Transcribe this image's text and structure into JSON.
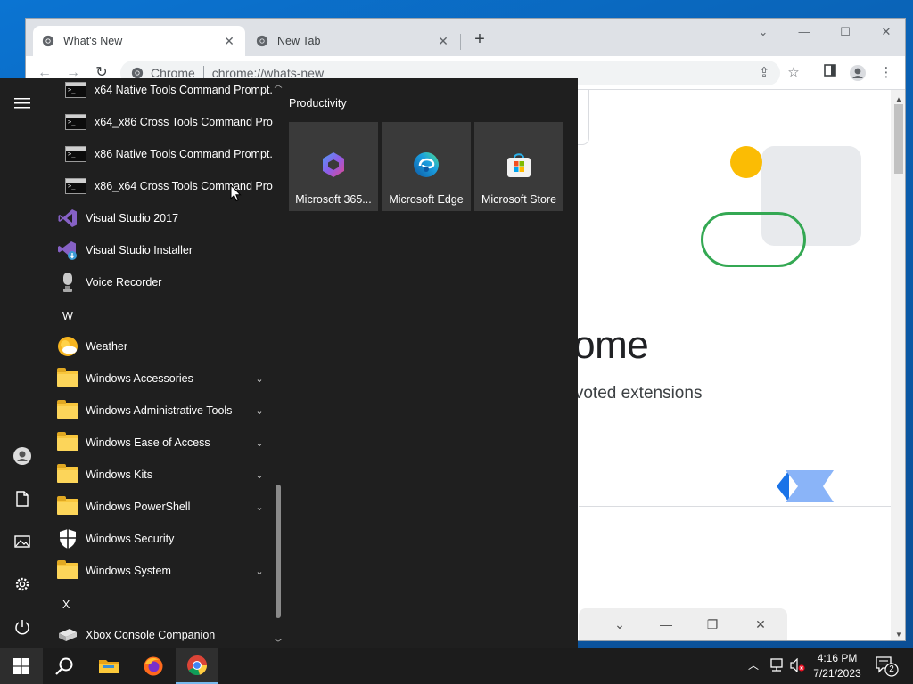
{
  "browser": {
    "tabs": [
      {
        "title": "What's New",
        "active": true
      },
      {
        "title": "New Tab",
        "active": false
      }
    ],
    "omnibox": {
      "site": "Chrome",
      "url": "chrome://whats-new"
    },
    "page": {
      "heading_fragment": "rome",
      "subtext_fragment": "o voted extensions"
    }
  },
  "start_menu": {
    "app_list": [
      {
        "label": "x64 Native Tools Command Prompt...",
        "icon": "cmd-icon",
        "expandable": false
      },
      {
        "label": "x64_x86 Cross Tools Command Pro...",
        "icon": "cmd-icon",
        "expandable": false
      },
      {
        "label": "x86 Native Tools Command Prompt...",
        "icon": "cmd-icon",
        "expandable": false
      },
      {
        "label": "x86_x64 Cross Tools Command Pro...",
        "icon": "cmd-icon",
        "expandable": false
      },
      {
        "label": "Visual Studio 2017",
        "icon": "visual-studio-icon",
        "expandable": false
      },
      {
        "label": "Visual Studio Installer",
        "icon": "vs-installer-icon",
        "expandable": false
      },
      {
        "label": "Voice Recorder",
        "icon": "microphone-icon",
        "expandable": false
      },
      {
        "letter": "W"
      },
      {
        "label": "Weather",
        "icon": "weather-icon",
        "expandable": false
      },
      {
        "label": "Windows Accessories",
        "icon": "folder-icon",
        "expandable": true
      },
      {
        "label": "Windows Administrative Tools",
        "icon": "folder-icon",
        "expandable": true
      },
      {
        "label": "Windows Ease of Access",
        "icon": "folder-icon",
        "expandable": true
      },
      {
        "label": "Windows Kits",
        "icon": "folder-icon",
        "expandable": true
      },
      {
        "label": "Windows PowerShell",
        "icon": "folder-icon",
        "expandable": true
      },
      {
        "label": "Windows Security",
        "icon": "shield-icon",
        "expandable": false
      },
      {
        "label": "Windows System",
        "icon": "folder-icon",
        "expandable": true
      },
      {
        "letter": "X"
      },
      {
        "label": "Xbox Console Companion",
        "icon": "xbox-console-icon",
        "expandable": false
      }
    ],
    "tile_group": {
      "title": "Productivity",
      "tiles": [
        {
          "label": "Microsoft 365...",
          "icon": "microsoft-365-icon"
        },
        {
          "label": "Microsoft Edge",
          "icon": "edge-icon"
        },
        {
          "label": "Microsoft Store",
          "icon": "store-icon"
        }
      ]
    }
  },
  "taskbar": {
    "apps": [
      "start",
      "search",
      "file-explorer",
      "firefox",
      "chrome"
    ],
    "clock": {
      "time": "4:16 PM",
      "date": "7/21/2023"
    },
    "notification_count": "2"
  }
}
